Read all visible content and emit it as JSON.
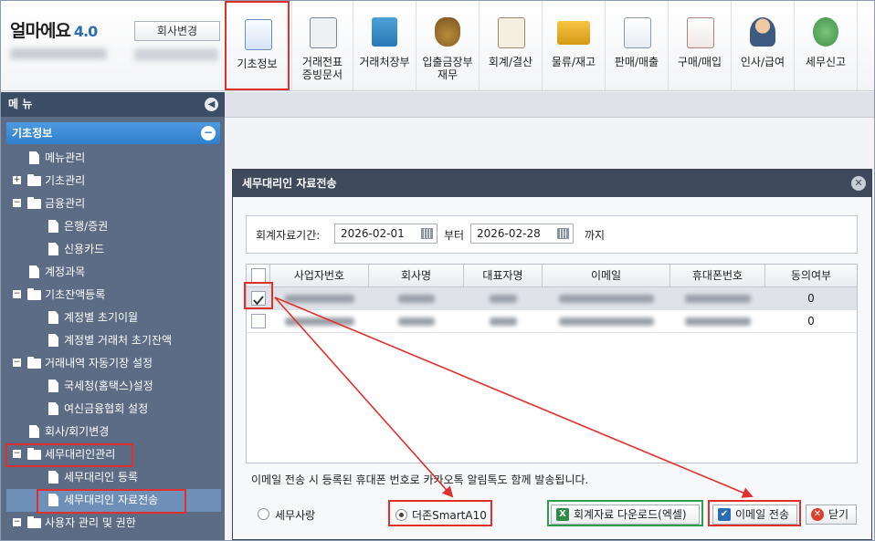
{
  "app": {
    "logo": "얼마에요",
    "version": "4.0",
    "company_change": "회사변경"
  },
  "toolbar": {
    "items": [
      {
        "label": "기초정보",
        "icon": "settings-document-icon"
      },
      {
        "label": "거래전표\n증빙문서",
        "icon": "voucher-icon"
      },
      {
        "label": "거래처장부",
        "icon": "ledger-book-icon"
      },
      {
        "label": "입출금장부\n재무",
        "icon": "money-bag-icon"
      },
      {
        "label": "회계/결산",
        "icon": "clipboard-icon"
      },
      {
        "label": "물류/재고",
        "icon": "cart-icon"
      },
      {
        "label": "판매/매출",
        "icon": "sales-icon"
      },
      {
        "label": "구매/매입",
        "icon": "purchase-icon"
      },
      {
        "label": "인사/급여",
        "icon": "person-icon"
      },
      {
        "label": "세무신고",
        "icon": "tax-icon"
      }
    ]
  },
  "menu": {
    "header": "메 뉴",
    "section": "기초정보",
    "items": [
      {
        "label": "메뉴관리",
        "type": "doc",
        "level": 1
      },
      {
        "label": "기초관리",
        "type": "folder-plus",
        "level": 0
      },
      {
        "label": "금융관리",
        "type": "folder-minus",
        "level": 0
      },
      {
        "label": "은행/증권",
        "type": "doc",
        "level": 2
      },
      {
        "label": "신용카드",
        "type": "doc",
        "level": 2
      },
      {
        "label": "계정과목",
        "type": "doc",
        "level": 1
      },
      {
        "label": "기초잔액등록",
        "type": "folder-minus",
        "level": 0
      },
      {
        "label": "계정별 초기이월",
        "type": "doc",
        "level": 2
      },
      {
        "label": "계정별 거래처 초기잔액",
        "type": "doc",
        "level": 2
      },
      {
        "label": "거래내역 자동기장 설정",
        "type": "folder-minus",
        "level": 0
      },
      {
        "label": "국세청(홈택스)설정",
        "type": "doc",
        "level": 2
      },
      {
        "label": "여신금융협회 설정",
        "type": "doc",
        "level": 2
      },
      {
        "label": "회사/회기변경",
        "type": "doc",
        "level": 1
      },
      {
        "label": "세무대리인관리",
        "type": "folder-minus",
        "level": 0
      },
      {
        "label": "세무대리인 등록",
        "type": "doc",
        "level": 2
      },
      {
        "label": "세무대리인 자료전송",
        "type": "doc",
        "level": 2
      },
      {
        "label": "사용자 관리 및 권한",
        "type": "folder-minus",
        "level": 0
      }
    ]
  },
  "dialog": {
    "title": "세무대리인 자료전송",
    "period_label": "회계자료기간:",
    "start_date": "2026-02-01",
    "from_label": "부터",
    "end_date": "2026-02-28",
    "to_label": "까지",
    "columns": [
      "사업자번호",
      "회사명",
      "대표자명",
      "이메일",
      "휴대폰번호",
      "동의여부"
    ],
    "rows": [
      {
        "checked": true,
        "agree": "0"
      },
      {
        "checked": false,
        "agree": "0"
      }
    ],
    "notice": "이메일 전송 시 등록된 휴대폰 번호로 카카오톡 알림톡도 함께 발송됩니다.",
    "radio_1": "세무사랑",
    "radio_2": "더존SmartA10",
    "btn_excel": "회계자료 다운로드(엑셀)",
    "btn_email": "이메일 전송",
    "btn_close": "닫기"
  },
  "colors": {
    "highlight": "#e0302e",
    "excel_box": "#2e9e4a",
    "menu_bg": "#5b6c84",
    "dialog_title": "#3e4a5b"
  }
}
